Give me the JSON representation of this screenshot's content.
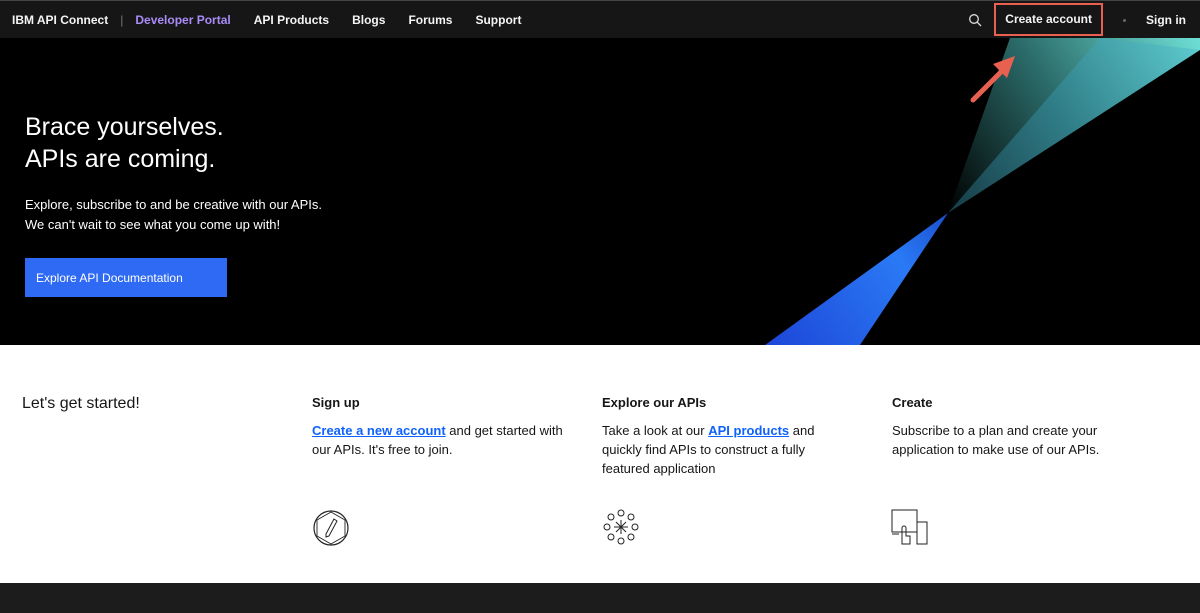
{
  "nav": {
    "brand": "IBM API Connect",
    "separator": "|",
    "portal": "Developer Portal",
    "links": [
      "API Products",
      "Blogs",
      "Forums",
      "Support"
    ],
    "create_account": "Create account",
    "sign_in": "Sign in"
  },
  "hero": {
    "title_line1": "Brace yourselves.",
    "title_line2": "APIs are coming.",
    "subtitle_line1": "Explore, subscribe to and be creative with our APIs.",
    "subtitle_line2": "We can't wait to see what you come up with!",
    "cta": "Explore API Documentation"
  },
  "intro": {
    "heading": "Let's get started!"
  },
  "cards": [
    {
      "title": "Sign up",
      "link": "Create a new account",
      "text": " and get started with our APIs. It's free to join.",
      "icon": "pencil-badge-icon"
    },
    {
      "title": "Explore our APIs",
      "pre": "Take a look at our ",
      "link": "API products",
      "text": " and quickly find APIs to construct a fully featured application",
      "icon": "api-cluster-icon"
    },
    {
      "title": "Create",
      "text": "Subscribe to a plan and create your application to make use of our APIs.",
      "icon": "touch-devices-icon"
    }
  ],
  "colors": {
    "accent": "#0f62fe",
    "highlight": "#e8604f",
    "portal": "#a98cf7"
  }
}
